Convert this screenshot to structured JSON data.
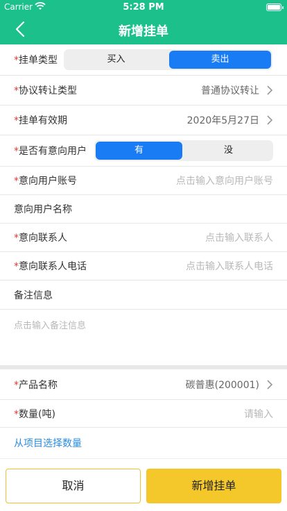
{
  "status_bar": {
    "carrier": "Carrier",
    "time": "5:28 PM"
  },
  "nav": {
    "title": "新增挂单",
    "back_icon": "chevron-left-icon"
  },
  "form": {
    "order_type": {
      "required": "*",
      "label": "挂单类型",
      "options": [
        "买入",
        "卖出"
      ],
      "selected": "卖出"
    },
    "transfer_type": {
      "required": "*",
      "label": "协议转让类型",
      "value": "普通协议转让"
    },
    "validity": {
      "required": "*",
      "label": "挂单有效期",
      "value": "2020年5月27日"
    },
    "intent_user": {
      "required": "*",
      "label": "是否有意向用户",
      "options": [
        "有",
        "没"
      ],
      "selected": "有"
    },
    "intent_account": {
      "required": "*",
      "label": "意向用户账号",
      "placeholder": "点击输入意向用户账号"
    },
    "intent_name": {
      "label": "意向用户名称"
    },
    "contact": {
      "required": "*",
      "label": "意向联系人",
      "placeholder": "点击输入联系人"
    },
    "contact_phone": {
      "required": "*",
      "label": "意向联系人电话",
      "placeholder": "点击输入联系人电话"
    },
    "remark": {
      "label": "备注信息",
      "placeholder": "点击输入备注信息"
    },
    "product": {
      "required": "*",
      "label": "产品名称",
      "value": "碳普惠(200001)"
    },
    "quantity": {
      "required": "*",
      "label": "数量(吨)",
      "placeholder": "请输入"
    },
    "select_from_project": "从项目选择数量"
  },
  "buttons": {
    "cancel": "取消",
    "submit": "新增挂单"
  },
  "colors": {
    "header": "#1cc08a",
    "segment_active": "#1a7cf5",
    "submit_button": "#f4c72a",
    "required": "#e53935",
    "link": "#2a8ce0"
  }
}
